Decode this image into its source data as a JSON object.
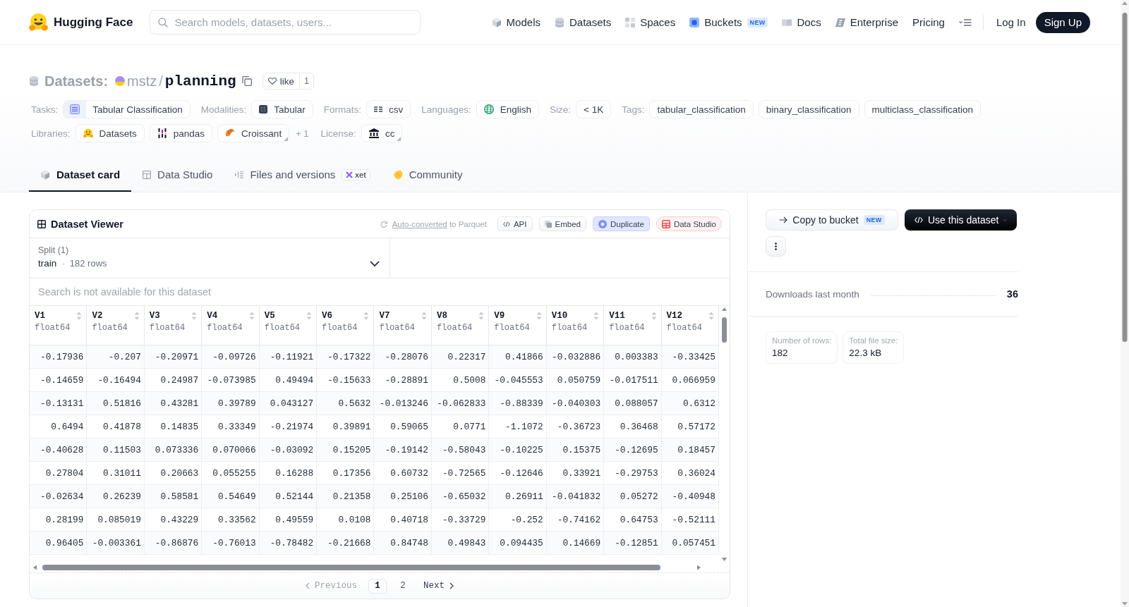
{
  "header": {
    "logo": "Hugging Face",
    "search": {
      "placeholder": "Search models, datasets, users..."
    },
    "nav": [
      {
        "label": "Models",
        "kind": "models"
      },
      {
        "label": "Datasets",
        "kind": "datasets"
      },
      {
        "label": "Spaces",
        "kind": "spaces"
      },
      {
        "label": "Buckets",
        "kind": "buckets",
        "badge": "NEW"
      },
      {
        "label": "Docs",
        "kind": "docs"
      },
      {
        "label": "Enterprise",
        "kind": "enterprise"
      },
      {
        "label": "Pricing",
        "kind": "pricing"
      }
    ],
    "login": "Log In",
    "signup": "Sign Up"
  },
  "title": {
    "section": "Datasets:",
    "owner": "mstz",
    "separator": "/",
    "name": "planning",
    "like": {
      "label": "like",
      "count": "1",
      "liked": false
    }
  },
  "metadata": [
    {
      "groups": [
        {
          "label": "Tasks:",
          "chips": [
            {
              "text": "Tabular Classification",
              "kind": "task",
              "expandable": false
            }
          ]
        },
        {
          "label": "Modalities:",
          "chips": [
            {
              "text": "Tabular",
              "kind": "modality",
              "expandable": false
            }
          ]
        },
        {
          "label": "Formats:",
          "chips": [
            {
              "text": "csv",
              "kind": "format",
              "expandable": false
            }
          ]
        },
        {
          "label": "Languages:",
          "chips": [
            {
              "text": "English",
              "kind": "language",
              "expandable": false
            }
          ]
        },
        {
          "label": "Size:",
          "chips": [
            {
              "text": "< 1K",
              "kind": "plain",
              "expandable": false
            }
          ]
        },
        {
          "label": "Tags:",
          "chips": [
            {
              "text": "tabular_classification",
              "kind": "plain",
              "expandable": false
            },
            {
              "text": "binary_classification",
              "kind": "plain",
              "expandable": false
            },
            {
              "text": "multiclass_classification",
              "kind": "plain",
              "expandable": false
            }
          ]
        }
      ]
    },
    {
      "groups": [
        {
          "label": "Libraries:",
          "chips": [
            {
              "text": "Datasets",
              "kind": "hf-library",
              "expandable": false
            },
            {
              "text": "pandas",
              "kind": "pandas",
              "expandable": false
            },
            {
              "text": "Croissant",
              "kind": "croissant",
              "expandable": true
            }
          ],
          "more": "+ 1"
        },
        {
          "label": "License:",
          "chips": [
            {
              "text": "cc",
              "kind": "license",
              "expandable": true
            }
          ]
        }
      ]
    }
  ],
  "tabs": [
    {
      "label": "Dataset card",
      "kind": "card",
      "selected": true
    },
    {
      "label": "Data Studio",
      "kind": "studio",
      "selected": false
    },
    {
      "label": "Files and versions",
      "kind": "files",
      "selected": false,
      "badge": "xet"
    },
    {
      "label": "Community",
      "kind": "community",
      "selected": false
    }
  ],
  "viewer": {
    "title": "Dataset Viewer",
    "conversion": {
      "link": "Auto-converted",
      "text": "to Parquet"
    },
    "actions": [
      {
        "label": "API",
        "kind": "api"
      },
      {
        "label": "Embed",
        "kind": "embed"
      },
      {
        "label": "Duplicate",
        "kind": "duplicate"
      },
      {
        "label": "Data Studio",
        "kind": "studio"
      }
    ],
    "split": {
      "label": "Split (1)",
      "value": "train",
      "separator": "·",
      "rows": "182 rows"
    },
    "search": {
      "placeholder": "Search is not available for this dataset"
    },
    "columns": [
      {
        "name": "V1",
        "type": "float64"
      },
      {
        "name": "V2",
        "type": "float64"
      },
      {
        "name": "V3",
        "type": "float64"
      },
      {
        "name": "V4",
        "type": "float64"
      },
      {
        "name": "V5",
        "type": "float64"
      },
      {
        "name": "V6",
        "type": "float64"
      },
      {
        "name": "V7",
        "type": "float64"
      },
      {
        "name": "V8",
        "type": "float64"
      },
      {
        "name": "V9",
        "type": "float64"
      },
      {
        "name": "V10",
        "type": "float64"
      },
      {
        "name": "V11",
        "type": "float64"
      },
      {
        "name": "V12",
        "type": "float64"
      }
    ],
    "rows": [
      [
        "-0.17936",
        "-0.207",
        "-0.20971",
        "-0.09726",
        "-0.11921",
        "-0.17322",
        "-0.28076",
        "0.22317",
        "0.41866",
        "-0.032886",
        "0.003383",
        "-0.33425"
      ],
      [
        "-0.14659",
        "-0.16494",
        "0.24987",
        "-0.073985",
        "0.49494",
        "-0.15633",
        "-0.28891",
        "0.5008",
        "-0.045553",
        "0.050759",
        "-0.017511",
        "0.066959"
      ],
      [
        "-0.13131",
        "0.51816",
        "0.43281",
        "0.39789",
        "0.043127",
        "0.5632",
        "-0.013246",
        "-0.062833",
        "-0.88339",
        "-0.040303",
        "0.088057",
        "0.6312"
      ],
      [
        "0.6494",
        "0.41878",
        "0.14835",
        "0.33349",
        "-0.21974",
        "0.39891",
        "0.59065",
        "0.0771",
        "-1.1072",
        "-0.36723",
        "0.36468",
        "0.57172"
      ],
      [
        "-0.40628",
        "0.11503",
        "0.073336",
        "0.070066",
        "-0.03092",
        "0.15205",
        "-0.19142",
        "-0.58043",
        "-0.10225",
        "0.15375",
        "-0.12695",
        "0.18457"
      ],
      [
        "0.27804",
        "0.31011",
        "0.20663",
        "0.055255",
        "0.16288",
        "0.17356",
        "0.60732",
        "-0.72565",
        "-0.12646",
        "0.33921",
        "-0.29753",
        "0.36024"
      ],
      [
        "-0.02634",
        "0.26239",
        "0.58581",
        "0.54649",
        "0.52144",
        "0.21358",
        "0.25106",
        "-0.65032",
        "0.26911",
        "-0.041832",
        "0.05272",
        "-0.40948"
      ],
      [
        "0.28199",
        "0.085019",
        "0.43229",
        "0.33562",
        "0.49559",
        "0.0108",
        "0.40718",
        "-0.33729",
        "-0.252",
        "-0.74162",
        "0.64753",
        "-0.52111"
      ],
      [
        "0.96405",
        "-0.003361",
        "-0.86876",
        "-0.76013",
        "-0.78482",
        "-0.21668",
        "0.84748",
        "0.49843",
        "0.094435",
        "0.14669",
        "-0.12851",
        "0.057451"
      ]
    ],
    "pagination": {
      "previous": {
        "label": "Previous",
        "disabled": true
      },
      "pages": [
        {
          "label": "1",
          "selected": true
        },
        {
          "label": "2",
          "selected": false
        }
      ],
      "next": {
        "label": "Next",
        "disabled": false
      }
    }
  },
  "sidebar": {
    "actions": [
      {
        "label": "Copy to bucket",
        "kind": "secondary",
        "badge": "NEW"
      },
      {
        "label": "Use this dataset",
        "kind": "primary"
      }
    ],
    "downloads": {
      "label": "Downloads last month",
      "value": "36"
    },
    "stats": [
      {
        "label": "Number of rows:",
        "value": "182"
      },
      {
        "label": "Total file size:",
        "value": "22.3 kB"
      }
    ]
  }
}
